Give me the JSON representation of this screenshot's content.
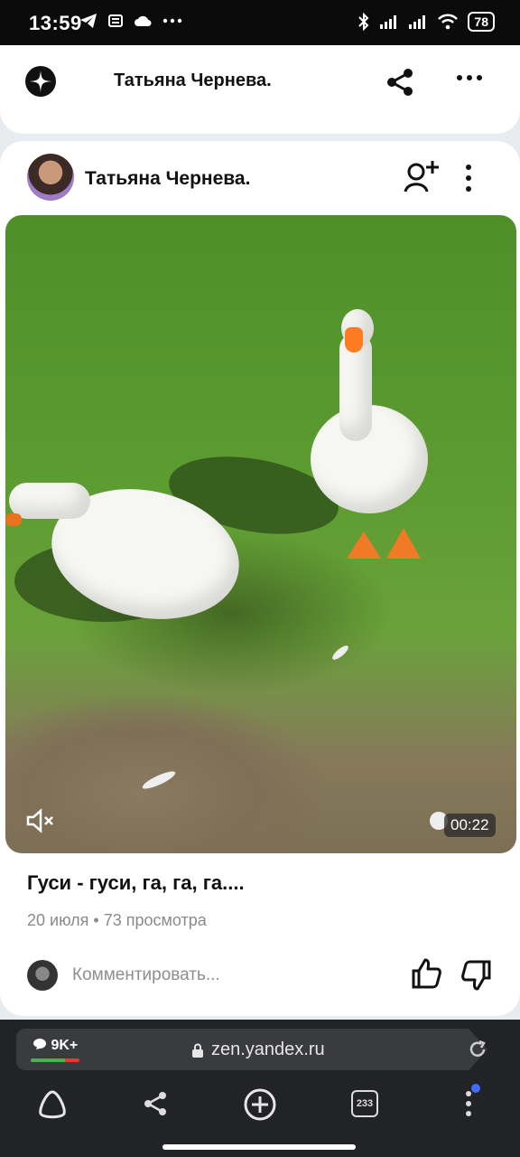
{
  "status_bar": {
    "time": "13:59",
    "battery": "78",
    "left_icons": [
      "telegram-icon",
      "news-icon",
      "cloud-icon",
      "more-dots-icon"
    ],
    "right_icons": [
      "bluetooth-icon",
      "signal-icon",
      "signal-icon",
      "wifi-icon",
      "battery-icon"
    ]
  },
  "header": {
    "title": "Татьяна Чернева.",
    "icons": [
      "zen-logo-icon",
      "share-icon",
      "more-horizontal-icon"
    ]
  },
  "post": {
    "author": "Татьяна Чернева.",
    "video": {
      "duration": "00:22",
      "muted": true
    },
    "title": "Гуси - гуси, га, га, га....",
    "meta": "20 июля • 73 просмотра",
    "comment_placeholder": "Комментировать..."
  },
  "browser": {
    "comments_badge": "9K+",
    "url": "zen.yandex.ru",
    "tabs_count": "233",
    "accent": "#3f6cff"
  }
}
